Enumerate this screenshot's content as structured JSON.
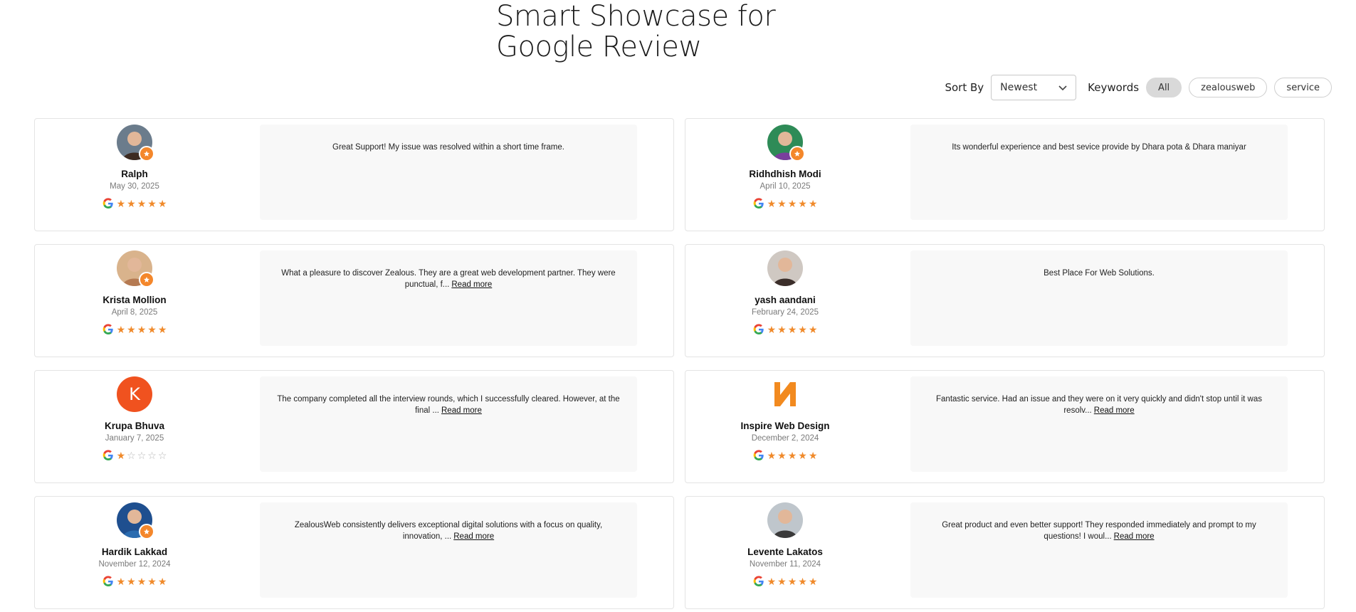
{
  "header": {
    "title_line1": "Smart Showcase for",
    "title_line2": "Google Review"
  },
  "controls": {
    "sort_label": "Sort By",
    "sort_value": "Newest",
    "keywords_label": "Keywords",
    "keywords": [
      {
        "label": "All",
        "active": true
      },
      {
        "label": "zealousweb",
        "active": false
      },
      {
        "label": "service",
        "active": false
      }
    ]
  },
  "colors": {
    "accent": "#f08a2b",
    "chip_active": "#d9d9d9",
    "card_bg": "#f8f8f8"
  },
  "reviews": [
    {
      "name": "Ralph",
      "date": "May 30, 2025",
      "rating": 5,
      "text": "Great Support! My issue was resolved within a short time frame.",
      "read_more": "",
      "avatar": "photo",
      "badge": true
    },
    {
      "name": "Ridhdhish Modi",
      "date": "April 10, 2025",
      "rating": 5,
      "text": "Its wonderful experience and best sevice provide by Dhara pota & Dhara maniyar",
      "read_more": "",
      "avatar": "photo",
      "badge": true
    },
    {
      "name": "Krista Mollion",
      "date": "April 8, 2025",
      "rating": 5,
      "text": "What a pleasure to discover Zealous. They are a great web development partner. They were punctual, f...",
      "read_more": "Read more",
      "avatar": "photo",
      "badge": true
    },
    {
      "name": "yash aandani",
      "date": "February 24, 2025",
      "rating": 5,
      "text": "Best Place For Web Solutions.",
      "read_more": "",
      "avatar": "photo",
      "badge": false
    },
    {
      "name": "Krupa Bhuva",
      "date": "January 7, 2025",
      "rating": 1,
      "text": "The company completed all the interview rounds, which I successfully cleared. However, at the final ...",
      "read_more": "Read more",
      "avatar": "letter",
      "initial": "K",
      "badge": false
    },
    {
      "name": "Inspire Web Design",
      "date": "December 2, 2024",
      "rating": 5,
      "text": "Fantastic service. Had an issue and they were on it very quickly and didn't stop until it was resolv...",
      "read_more": "Read more",
      "avatar": "logo",
      "badge": false
    },
    {
      "name": "Hardik Lakkad",
      "date": "November 12, 2024",
      "rating": 5,
      "text": "ZealousWeb consistently delivers exceptional digital solutions with a focus on quality, innovation, ...",
      "read_more": "Read more",
      "avatar": "photo",
      "badge": true
    },
    {
      "name": "Levente Lakatos",
      "date": "November 11, 2024",
      "rating": 5,
      "text": "Great product and even better support! They responded immediately and prompt to my questions! I woul...",
      "read_more": "Read more",
      "avatar": "photo",
      "badge": false
    }
  ]
}
